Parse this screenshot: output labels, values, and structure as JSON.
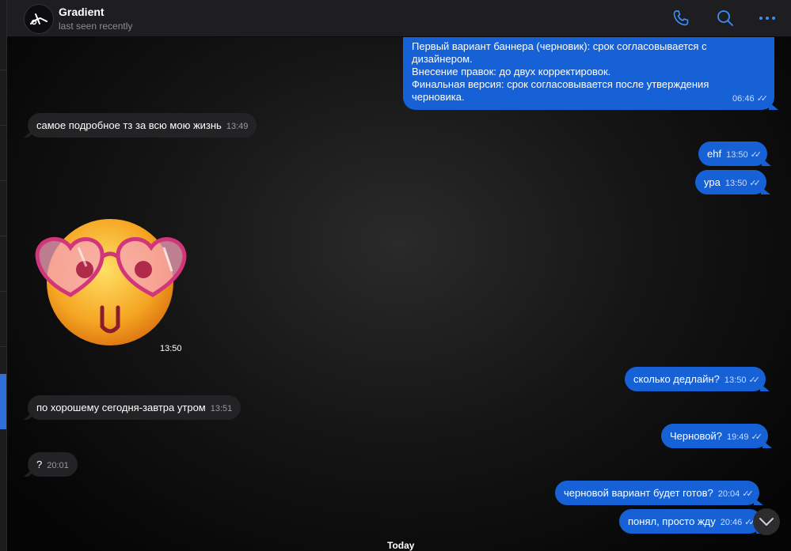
{
  "header": {
    "title": "Gradient",
    "subtitle": "last seen recently",
    "icons": [
      "phone-icon",
      "search-icon",
      "more-icon"
    ]
  },
  "messages": {
    "m1": {
      "line1": "Первый вариант баннера (черновик): срок согласовывается с",
      "line2": "дизайнером.",
      "line3": "Внесение правок: до двух  корректировок.",
      "line4": "Финальная версия: срок согласовывается после утверждения",
      "line5": "черновика.",
      "time": "06:46"
    },
    "m2": {
      "text": "самое подробное тз за всю мою жизнь",
      "time": "13:49"
    },
    "m3": {
      "text": "ehf",
      "time": "13:50"
    },
    "m4": {
      "text": "ура",
      "time": "13:50"
    },
    "sticker": {
      "time": "13:50"
    },
    "m5": {
      "text": "сколько дедлайн?",
      "time": "13:50"
    },
    "m6": {
      "text": "по хорошему сегодня-завтра утром",
      "time": "13:51"
    },
    "m7": {
      "text": "Черновой?",
      "time": "19:49"
    },
    "m8": {
      "text": "?",
      "time": "20:01"
    },
    "m9": {
      "text": "черновой вариант будет готов?",
      "time": "20:04"
    },
    "m10": {
      "text": "понял, просто жду",
      "time": "20:46"
    }
  },
  "date_separator": "Today",
  "colors": {
    "outgoing": "#1761d6",
    "incoming": "#232325",
    "accent": "#2f6fdc"
  }
}
